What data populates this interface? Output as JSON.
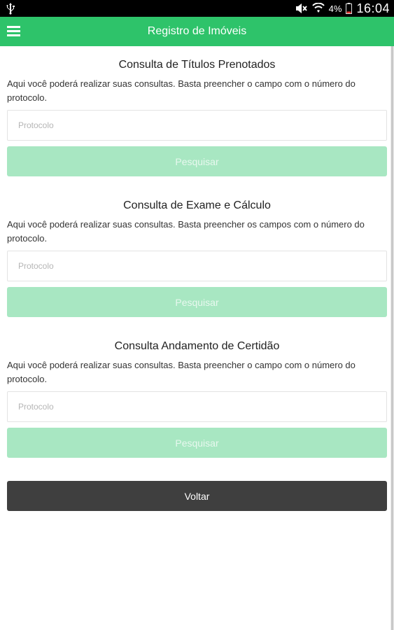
{
  "status_bar": {
    "battery_percent": "4%",
    "time": "16:04",
    "icons": [
      "usb-icon",
      "mute-icon",
      "wifi-icon",
      "battery-icon"
    ]
  },
  "app_bar": {
    "title": "Registro de Imóveis",
    "menu_icon": "menu-icon",
    "color": "#2ec36a"
  },
  "sections": [
    {
      "title": "Consulta de Títulos Prenotados",
      "description": "Aqui você poderá realizar suas consultas. Basta preencher o campo com o número do protocolo.",
      "input_placeholder": "Protocolo",
      "button_label": "Pesquisar"
    },
    {
      "title": "Consulta de Exame e Cálculo",
      "description": "Aqui você poderá realizar suas consultas. Basta preencher os campos com o número do protocolo.",
      "input_placeholder": "Protocolo",
      "button_label": "Pesquisar"
    },
    {
      "title": "Consulta Andamento de Certidão",
      "description": "Aqui você poderá realizar suas consultas. Basta preencher o campo com o número do protocolo.",
      "input_placeholder": "Protocolo",
      "button_label": "Pesquisar"
    }
  ],
  "back_button_label": "Voltar",
  "colors": {
    "accent": "#2ec36a",
    "button_disabled": "#a8e7c2",
    "back_button": "#3f3f3f"
  }
}
